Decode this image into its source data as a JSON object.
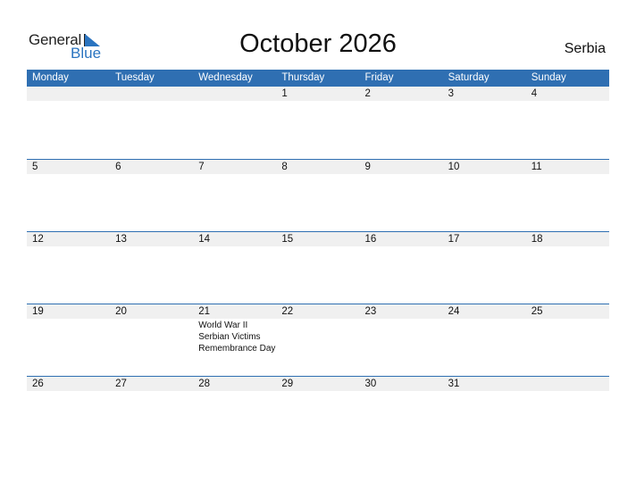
{
  "logo": {
    "word1": "General",
    "word2": "Blue"
  },
  "header": {
    "title": "October 2026",
    "country": "Serbia"
  },
  "colors": {
    "accent": "#2f6fb2",
    "band": "#f0f0f0"
  },
  "weekdays": [
    "Monday",
    "Tuesday",
    "Wednesday",
    "Thursday",
    "Friday",
    "Saturday",
    "Sunday"
  ],
  "weeks": [
    {
      "days": [
        {
          "n": ""
        },
        {
          "n": ""
        },
        {
          "n": ""
        },
        {
          "n": "1"
        },
        {
          "n": "2"
        },
        {
          "n": "3"
        },
        {
          "n": "4"
        }
      ]
    },
    {
      "days": [
        {
          "n": "5"
        },
        {
          "n": "6"
        },
        {
          "n": "7"
        },
        {
          "n": "8"
        },
        {
          "n": "9"
        },
        {
          "n": "10"
        },
        {
          "n": "11"
        }
      ]
    },
    {
      "days": [
        {
          "n": "12"
        },
        {
          "n": "13"
        },
        {
          "n": "14"
        },
        {
          "n": "15"
        },
        {
          "n": "16"
        },
        {
          "n": "17"
        },
        {
          "n": "18"
        }
      ]
    },
    {
      "days": [
        {
          "n": "19"
        },
        {
          "n": "20"
        },
        {
          "n": "21",
          "holiday": "World War II Serbian Victims Remembrance Day"
        },
        {
          "n": "22"
        },
        {
          "n": "23"
        },
        {
          "n": "24"
        },
        {
          "n": "25"
        }
      ]
    },
    {
      "days": [
        {
          "n": "26"
        },
        {
          "n": "27"
        },
        {
          "n": "28"
        },
        {
          "n": "29"
        },
        {
          "n": "30"
        },
        {
          "n": "31"
        },
        {
          "n": ""
        }
      ]
    }
  ]
}
